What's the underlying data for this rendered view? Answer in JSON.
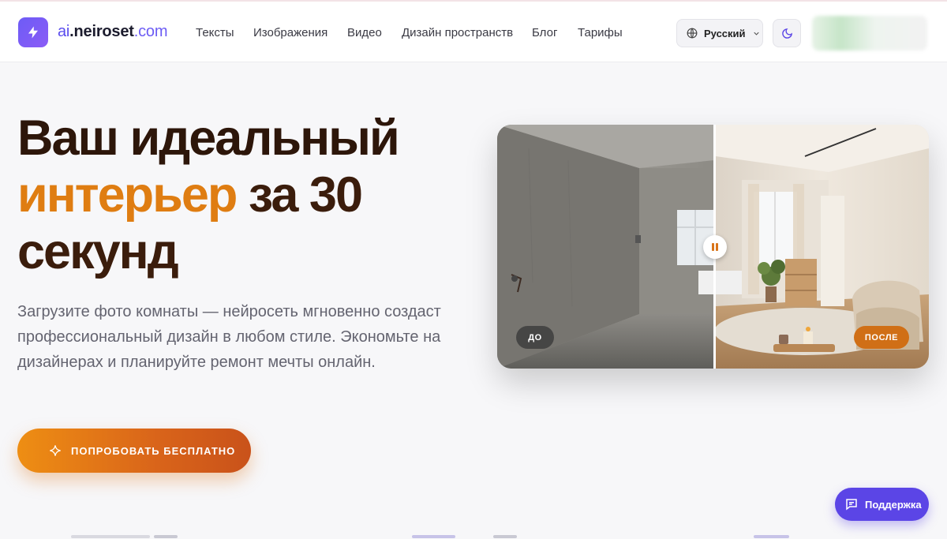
{
  "header": {
    "logo_prefix": "ai",
    "logo_name": ".neiroset",
    "logo_suffix": ".com",
    "nav": [
      {
        "label": "Тексты"
      },
      {
        "label": "Изображения"
      },
      {
        "label": "Видео"
      },
      {
        "label": "Дизайн пространств"
      },
      {
        "label": "Блог"
      },
      {
        "label": "Тарифы"
      }
    ],
    "language": "Русский"
  },
  "hero": {
    "title_line1": "Ваш идеальный",
    "title_highlight": "интерьер",
    "title_line2_rest": " за 30",
    "title_line3": "секунд",
    "subtitle": "Загрузите фото комнаты — нейросеть мгновенно создаст профессиональный дизайн в любом стиле. Экономьте на дизайнерах и планируйте ремонт мечты онлайн.",
    "cta_label": "ПОПРОБОВАТЬ БЕСПЛАТНО"
  },
  "compare": {
    "before_label": "ДО",
    "after_label": "ПОСЛЕ"
  },
  "support_label": "Поддержка",
  "colors": {
    "brand": "#5b4dee",
    "accent_orange": "#df7d12",
    "support": "#5b45e6"
  },
  "icons": {
    "logo": "bolt-icon",
    "language": "globe-icon",
    "theme": "moon-icon",
    "cta": "sparkle-icon",
    "compare_control": "pause-icon",
    "support": "chat-icon"
  }
}
